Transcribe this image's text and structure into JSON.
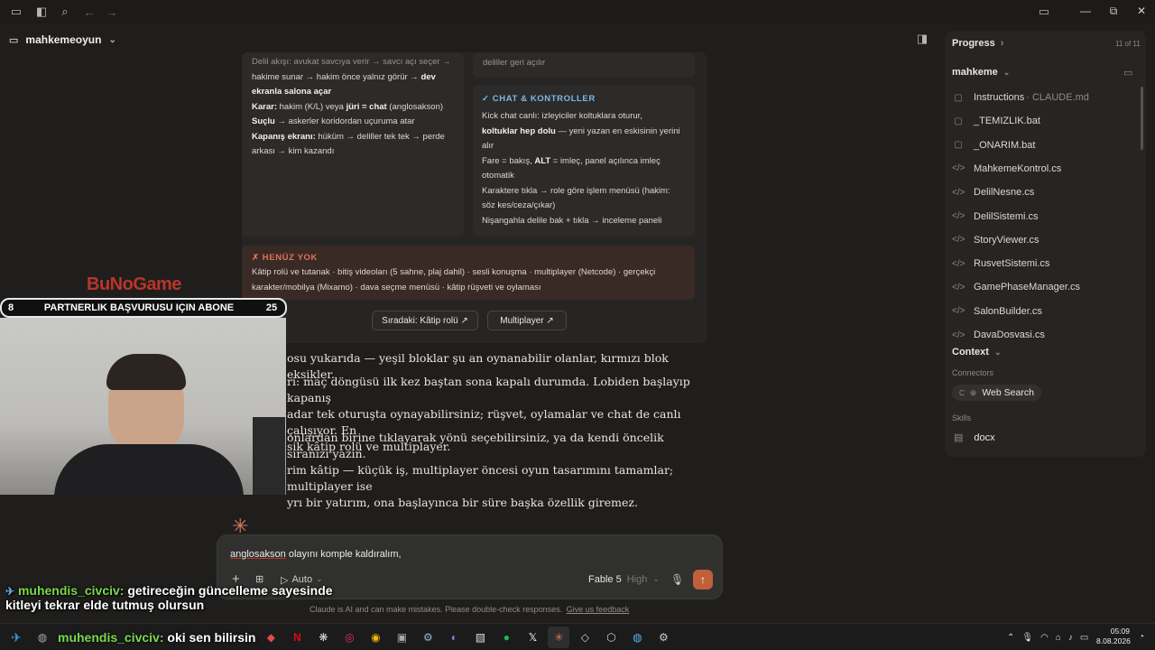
{
  "window": {
    "icons": [
      "sidebar-icon",
      "search-icon",
      "back-icon",
      "forward-icon"
    ],
    "controls": [
      "minimize",
      "maximize",
      "close"
    ]
  },
  "project": {
    "name": "mahkemeoyun"
  },
  "doc": {
    "flow_box": {
      "line0": "Delil akışı: avukat savcıya verir → savcı açı seçer →",
      "line1_a": "hakime sunar → hakim önce yalnız görür → ",
      "line1_b": "dev",
      "line2": "ekranla salona açar",
      "karar_label": "Karar:",
      "karar_a": " hakim (K/L) veya ",
      "karar_b": "jüri = chat",
      "karar_c": " (anglosakson)",
      "suclu_label": "Suçlu",
      "suclu_text": " → askerler koridordan uçuruma atar",
      "kapanis_label": "Kapanış ekranı:",
      "kapanis_text": " hüküm → deliller tek tek → perde",
      "kapanis_text2": "arkası → kim kazandı"
    },
    "top_right_text": "deliller geri açılır",
    "chat_box": {
      "heading": "✓ CHAT & KONTROLLER",
      "l1": "Kick chat canlı: izleyiciler koltuklara oturur,",
      "l2_b": "koltuklar hep dolu",
      "l2": " — yeni yazan en eskisinin yerini",
      "l3": "alır",
      "l4_a": "Fare = bakış, ",
      "l4_b": "ALT",
      "l4_c": " = imleç, panel açılınca imleç",
      "l5": "otomatik",
      "l6": "Karaktere tıkla → role göre işlem menüsü (hakim:",
      "l7": "söz kes/ceza/çıkar)",
      "l8": "Nişangahla delile bak + tıkla → inceleme paneli"
    },
    "missing_box": {
      "heading": "✗ HENÜZ YOK",
      "l1": "Kâtip rolü ve tutanak · bitiş videoları (5 sahne, plaj dahil) · sesli konuşma · multiplayer (Netcode) · gerçekçi",
      "l2": "karakter/mobilya (Mixamo) · dava seçme menüsü · kâtip rüşveti ve oylaması"
    },
    "buttons": {
      "next": "Sıradaki: Kâtip rolü ↗",
      "multi": "Multiplayer ↗"
    }
  },
  "answer": {
    "p1": "osu yukarıda — yeşil bloklar şu an oynanabilir olanlar, kırmızı blok eksikler.",
    "p2_l1": "ri: maç döngüsü ilk kez baştan sona kapalı durumda. Lobiden başlayıp kapanış",
    "p2_l2": "adar tek oturuşta oynayabilirsiniz; rüşvet, oylamalar ve chat de canlı çalışıyor. En",
    "p2_l3": "sik kâtip rolü ve multiplayer.",
    "p3_l1": "onlardan birine tıklayarak yönü seçebilirsiniz, ya da kendi öncelik sıranızı yazın.",
    "p3_l2": "rim kâtip — küçük iş, multiplayer öncesi oyun tasarımını tamamlar; multiplayer ise",
    "p3_l3": "yrı bir yatırım, ona başlayınca bir süre başka özellik giremez."
  },
  "stream": {
    "logo": "BuNoGame",
    "banner_left": "8",
    "banner_text": "PARTNERLIK BAŞVURUSU IÇIN ABONE",
    "banner_right": "25",
    "chat1_name": "muhendis_civciv:",
    "chat1_text": " getireceğin güncelleme sayesinde",
    "chat1_text2": "kitleyi tekrar elde tutmuş olursun",
    "chat2_name": "muhendis_civciv:",
    "chat2_text": " oki sen bilirsin"
  },
  "input": {
    "value_a": "anglosakson",
    "value_b": " olayını komple kaldıralım,",
    "mode": "Auto",
    "model": "Fable 5",
    "effort": "High",
    "disclaimer": "Claude is AI and can make mistakes. Please double-check responses.",
    "feedback": "Give us feedback"
  },
  "panel": {
    "progress_title": "Progress",
    "progress_count": "11 of 11",
    "folder": "mahkeme",
    "files": [
      {
        "name": "Instructions",
        "sub": " · CLAUDE.md",
        "icon": "doc-icon"
      },
      {
        "name": "_TEMIZLIK.bat",
        "sub": "",
        "icon": "doc-icon"
      },
      {
        "name": "_ONARIM.bat",
        "sub": "",
        "icon": "doc-icon"
      },
      {
        "name": "MahkemeKontrol.cs",
        "sub": "",
        "icon": "code-icon"
      },
      {
        "name": "DelilNesne.cs",
        "sub": "",
        "icon": "code-icon"
      },
      {
        "name": "DelilSistemi.cs",
        "sub": "",
        "icon": "code-icon"
      },
      {
        "name": "StoryViewer.cs",
        "sub": "",
        "icon": "code-icon"
      },
      {
        "name": "RusvetSistemi.cs",
        "sub": "",
        "icon": "code-icon"
      },
      {
        "name": "GamePhaseManager.cs",
        "sub": "",
        "icon": "code-icon"
      },
      {
        "name": "SalonBuilder.cs",
        "sub": "",
        "icon": "code-icon"
      },
      {
        "name": "DavaDosyasi.cs",
        "sub": "",
        "icon": "code-icon"
      }
    ],
    "context_title": "Context",
    "connectors_label": "Connectors",
    "connector": "Web Search",
    "skills_label": "Skills",
    "skill": "docx"
  },
  "taskbar": {
    "time": "05:09",
    "date": "8.08.2026"
  },
  "colors": {
    "accent": "#d97757",
    "green_heading": "#7ab8e8",
    "red_heading": "#e0705a"
  }
}
